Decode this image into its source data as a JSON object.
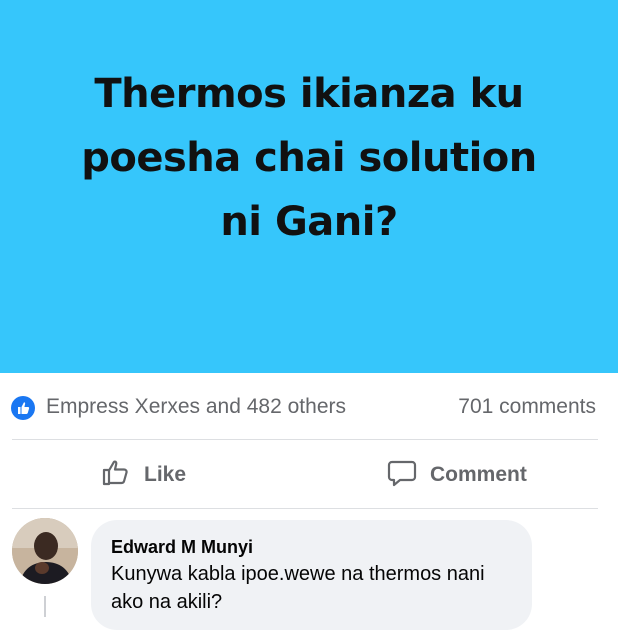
{
  "post": {
    "image_text_lines": [
      "Thermos ikianza ku",
      "poesha chai solution",
      "ni Gani?"
    ],
    "background_color": "#36c6fb"
  },
  "reactions": {
    "icon": "thumbs-up-icon",
    "summary": "Empress Xerxes and 482 others",
    "comments_count": "701 comments"
  },
  "actions": {
    "like_icon": "thumbs-up-outline-icon",
    "like_label": "Like",
    "comment_icon": "speech-bubble-icon",
    "comment_label": "Comment"
  },
  "comment": {
    "author": "Edward M Munyi",
    "text": "Kunywa kabla ipoe.wewe na thermos nani ako na akili?"
  },
  "colors": {
    "accent": "#1a77f2",
    "muted_text": "#65676b",
    "bubble": "#f0f2f5"
  }
}
